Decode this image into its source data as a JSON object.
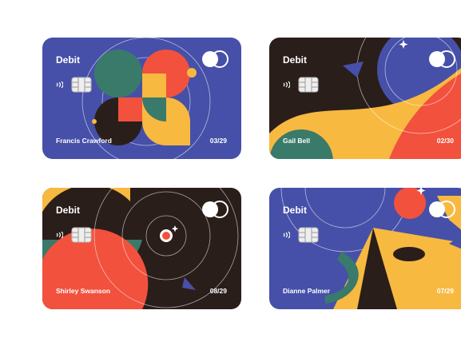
{
  "cards": [
    {
      "type_label": "Debit",
      "holder": "Francis Crawford",
      "expiry": "03/29"
    },
    {
      "type_label": "Debit",
      "holder": "Gail Bell",
      "expiry": "02/30"
    },
    {
      "type_label": "Debit",
      "holder": "Shirley Swanson",
      "expiry": "08/29"
    },
    {
      "type_label": "Debit",
      "holder": "Dianne Palmer",
      "expiry": "07/29"
    }
  ],
  "colors": {
    "blue": "#4650a8",
    "dark": "#2a1e1a",
    "red": "#f2513d",
    "yellow": "#f7b940",
    "teal": "#3a7a6a",
    "white": "#ffffff"
  },
  "icons": [
    "contactless-icon",
    "chip-icon",
    "card-network-logo"
  ]
}
